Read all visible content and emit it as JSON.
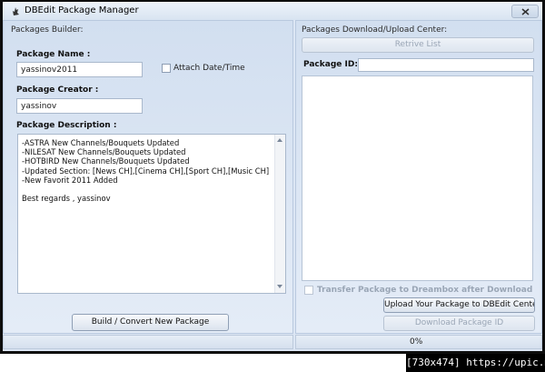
{
  "window": {
    "title": "DBEdit Package Manager",
    "close_icon": "close-icon"
  },
  "builder": {
    "group_title": "Packages Builder:",
    "package_name_label": "Package Name :",
    "package_name_value": "yassinov2011",
    "attach_date_label": "Attach Date/Time",
    "attach_date_checked": false,
    "package_creator_label": "Package Creator :",
    "package_creator_value": "yassinov",
    "package_description_label": "Package Description :",
    "package_description_value": "-ASTRA New Channels/Bouquets Updated\n-NILESAT New Channels/Bouquets Updated\n-HOTBIRD New Channels/Bouquets Updated\n-Updated Section: [News CH],[Cinema CH],[Sport CH],[Music CH]\n-New Favorit 2011 Added\n\nBest regards , yassinov",
    "build_button": "Build / Convert New Package"
  },
  "center": {
    "group_title": "Packages Download/Upload Center:",
    "retrieve_button": "Retrive List",
    "package_id_label": "Package ID:",
    "package_id_value": "",
    "transfer_label": "Transfer Package to Dreambox after Download",
    "transfer_checked": false,
    "upload_button": "Upload Your Package to DBEdit Center",
    "download_button": "Download Package ID"
  },
  "status": {
    "progress_text": "0%",
    "progress_fraction": 0
  },
  "footer": {
    "badge_text": "[730x474] https://upic.me/"
  },
  "colors": {
    "panel_bg": "#dce6f4",
    "border": "#b9c9df",
    "disabled_text": "#9aa6b6"
  }
}
